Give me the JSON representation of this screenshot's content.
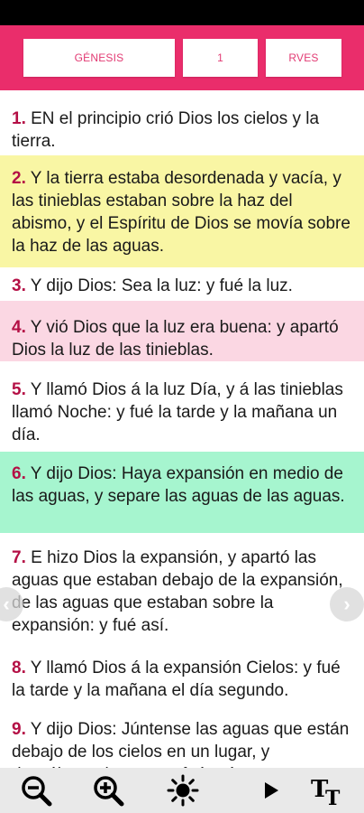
{
  "header": {
    "book": "GÉNESIS",
    "chapter": "1",
    "version": "RVES"
  },
  "verses": [
    {
      "num": "1.",
      "text": " EN el principio crió Dios los cielos y la tierra.",
      "bg": "#ffffff"
    },
    {
      "num": "2.",
      "text": " Y la tierra estaba desordenada y vacía, y las tinieblas estaban sobre la haz del abismo, y el Espíritu de Dios se movía sobre la haz de las aguas.",
      "bg": "#f9f6a4"
    },
    {
      "num": "3.",
      "text": " Y dijo Dios: Sea la luz: y fué la luz.",
      "bg": "#ffffff"
    },
    {
      "num": "4.",
      "text": " Y vió Dios que la luz era buena: y apartó Dios la luz de las tinieblas.",
      "bg": "#fbd7e3"
    },
    {
      "num": "5.",
      "text": " Y llamó Dios á la luz Día, y á las tinieblas llamó Noche: y fué la tarde y la mañana un día.",
      "bg": "#ffffff"
    },
    {
      "num": "6.",
      "text": " Y dijo Dios: Haya expansión en medio de las aguas, y separe las aguas de las aguas.",
      "bg": "#a6f5cf"
    },
    {
      "num": "7.",
      "text": " E hizo Dios la expansión, y apartó las aguas que estaban debajo de la expansión, de las aguas que estaban sobre la expansión: y fué así.",
      "bg": "#ffffff"
    },
    {
      "num": "8.",
      "text": " Y llamó Dios á la expansión Cielos: y fué la tarde y la mañana el día segundo.",
      "bg": "#ffffff"
    },
    {
      "num": "9.",
      "text": " Y dijo Dios: Júntense las aguas que están debajo de los cielos en un lugar, y descúbrase la seca: y fué así.",
      "bg": "#ffffff"
    }
  ],
  "toolbar": {
    "icons": [
      "zoom-out-icon",
      "zoom-in-icon",
      "brightness-icon",
      "play-icon",
      "text-size-icon"
    ]
  },
  "colors": {
    "accent": "#ea2d6b",
    "verse_number": "#b40f45"
  }
}
